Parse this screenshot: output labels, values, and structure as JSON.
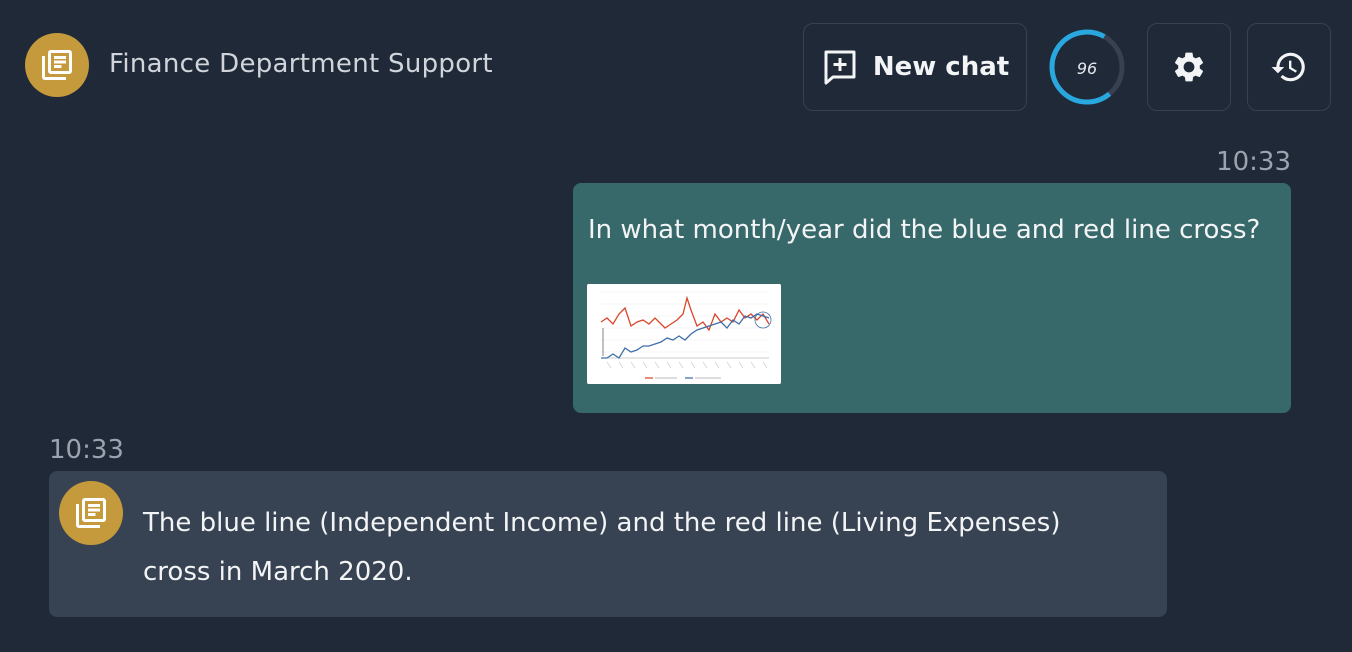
{
  "header": {
    "title": "Finance Department Support",
    "avatar_icon": "document-list-icon",
    "new_chat_label": "New chat",
    "new_chat_icon": "add-chat-icon",
    "gauge_value": 96,
    "gauge_color": "#29a8e0",
    "settings_icon": "gear-icon",
    "history_icon": "history-icon"
  },
  "messages": [
    {
      "role": "user",
      "time": "10:33",
      "text": "In what month/year did the blue and red line cross?",
      "attachment": {
        "type": "chart-thumbnail",
        "series_colors": [
          "#d9472b",
          "#3f6fa8"
        ]
      }
    },
    {
      "role": "assistant",
      "time": "10:33",
      "text": "The blue line (Independent Income) and the red line (Living Expenses) cross in March 2020."
    }
  ],
  "colors": {
    "background": "#1f2937",
    "user_bubble": "#38696a",
    "assistant_bubble": "#374352",
    "avatar": "#c49a3c"
  }
}
